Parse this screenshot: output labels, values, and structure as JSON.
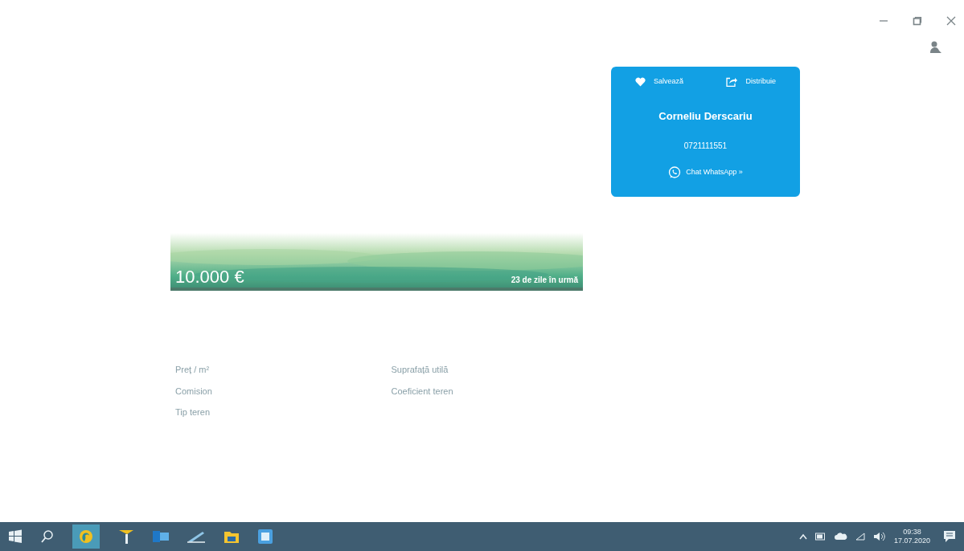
{
  "contact_card": {
    "actions": [
      {
        "kind": "save",
        "label": "Salvează"
      },
      {
        "kind": "share",
        "label": "Distribuie"
      }
    ],
    "name": "Corneliu Derscariu",
    "phone": "0721111551",
    "chat": "Chat WhatsApp »"
  },
  "listing": {
    "price": "10.000 €",
    "age": "23 de zile în urmă",
    "details": [
      {
        "label": "Preț / m²"
      },
      {
        "label": "Suprafață utilă"
      },
      {
        "label": "Comision"
      },
      {
        "label": "Coeficient teren"
      },
      {
        "label": "Tip teren"
      }
    ]
  },
  "taskbar": {
    "time": "09:38",
    "date": "17.07.2020"
  }
}
